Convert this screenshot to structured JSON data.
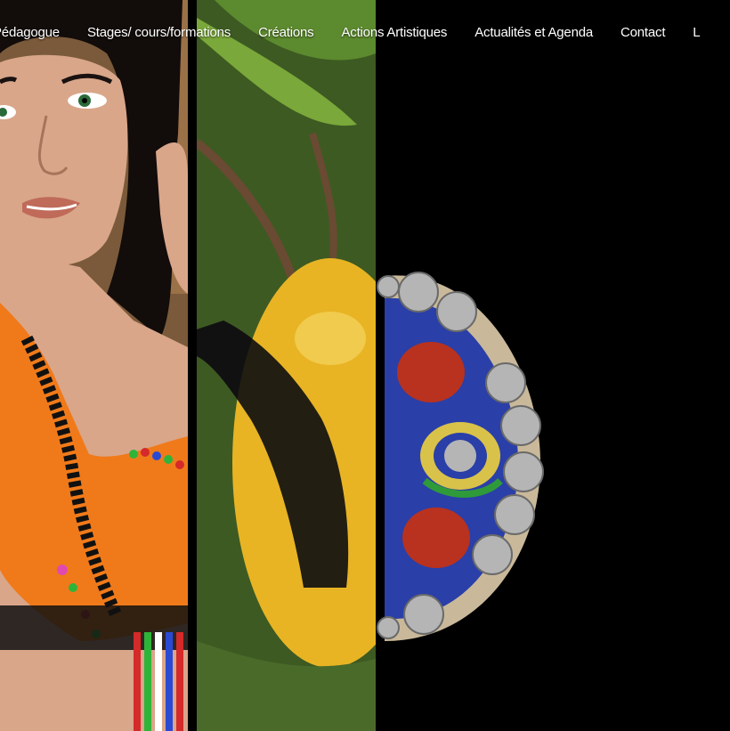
{
  "nav": {
    "items": [
      {
        "label": "Pédagogue"
      },
      {
        "label": "Stages/ cours/formations"
      },
      {
        "label": "Créations"
      },
      {
        "label": "Actions Artistiques"
      },
      {
        "label": "Actualités et Agenda"
      },
      {
        "label": "Contact"
      },
      {
        "label": "L"
      }
    ]
  },
  "colors": {
    "background": "#000000",
    "nav_text": "#ffffff",
    "costume_orange": "#f07a1a",
    "fruit_yellow": "#e8b424",
    "jewel_red": "#b8321f",
    "jewel_silver": "#b5b5b5",
    "jewel_blue": "#2a3fa8",
    "jewel_green": "#2f9a3a"
  },
  "hero": {
    "panels": [
      {
        "name": "dancer-portrait",
        "icon": "dancer-photo"
      },
      {
        "name": "tropical-plant",
        "icon": "plant-photo"
      },
      {
        "name": "berber-jewel",
        "icon": "jewel-photo"
      }
    ]
  }
}
